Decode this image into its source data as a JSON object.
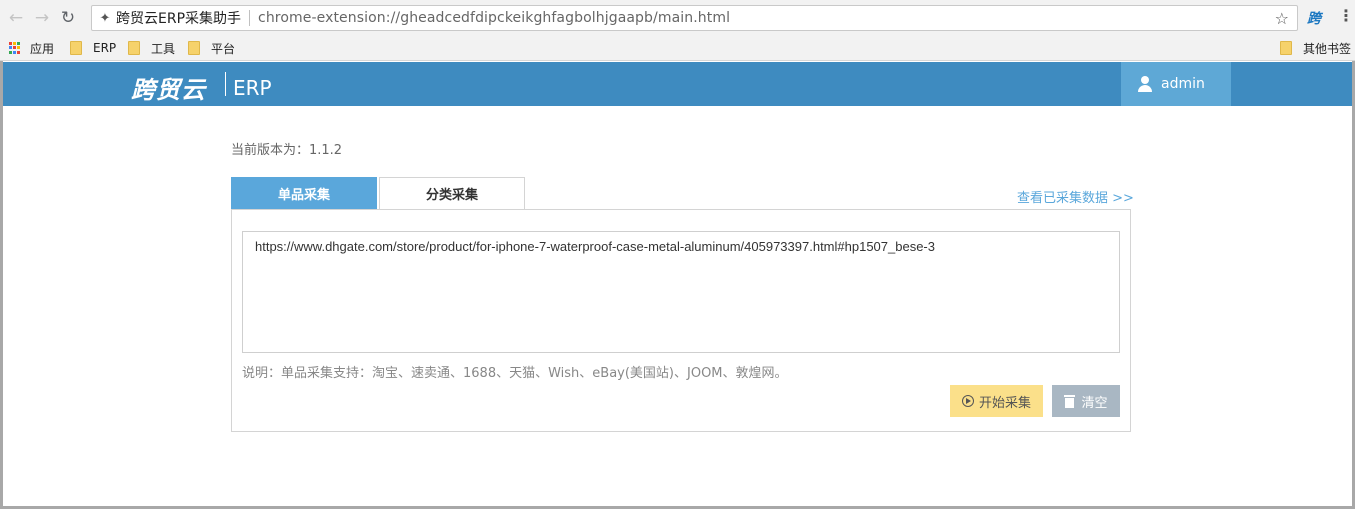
{
  "browser": {
    "tab_title": "跨贸云ERP采集助手",
    "url": "chrome-extension://gheadcedfdipckeikghfagbolhjgaapb/main.html",
    "icons": {
      "back": "arrow-left-icon",
      "forward": "arrow-right-icon",
      "reload": "reload-icon",
      "extension": "puzzle-icon",
      "bookmark": "star-icon",
      "menu": "kebab-menu-icon"
    },
    "ext_logo": "跨"
  },
  "bookmarks": {
    "apps_label": "应用",
    "items": [
      "ERP",
      "工具",
      "平台"
    ],
    "other_label": "其他书签",
    "folder_color": "#f6d26b"
  },
  "header": {
    "logo": "跨贸云",
    "product": "ERP",
    "user": "admin",
    "bg_color": "#3e8bc0",
    "user_bg_color": "#5ea8d6"
  },
  "content": {
    "version_text": "当前版本为：1.1.2",
    "tabs": [
      {
        "label": "单品采集",
        "active": true
      },
      {
        "label": "分类采集",
        "active": false
      }
    ],
    "view_link": "查看已采集数据 >>",
    "url_value": "https://www.dhgate.com/store/product/for-iphone-7-waterproof-case-metal-aluminum/405973397.html#hp1507_bese-3",
    "hint": "说明：单品采集支持：淘宝、速卖通、1688、天猫、Wish、eBay(美国站)、JOOM、敦煌网。",
    "buttons": {
      "start": "开始采集",
      "clear": "清空"
    },
    "accent_color": "#5aa7db"
  }
}
